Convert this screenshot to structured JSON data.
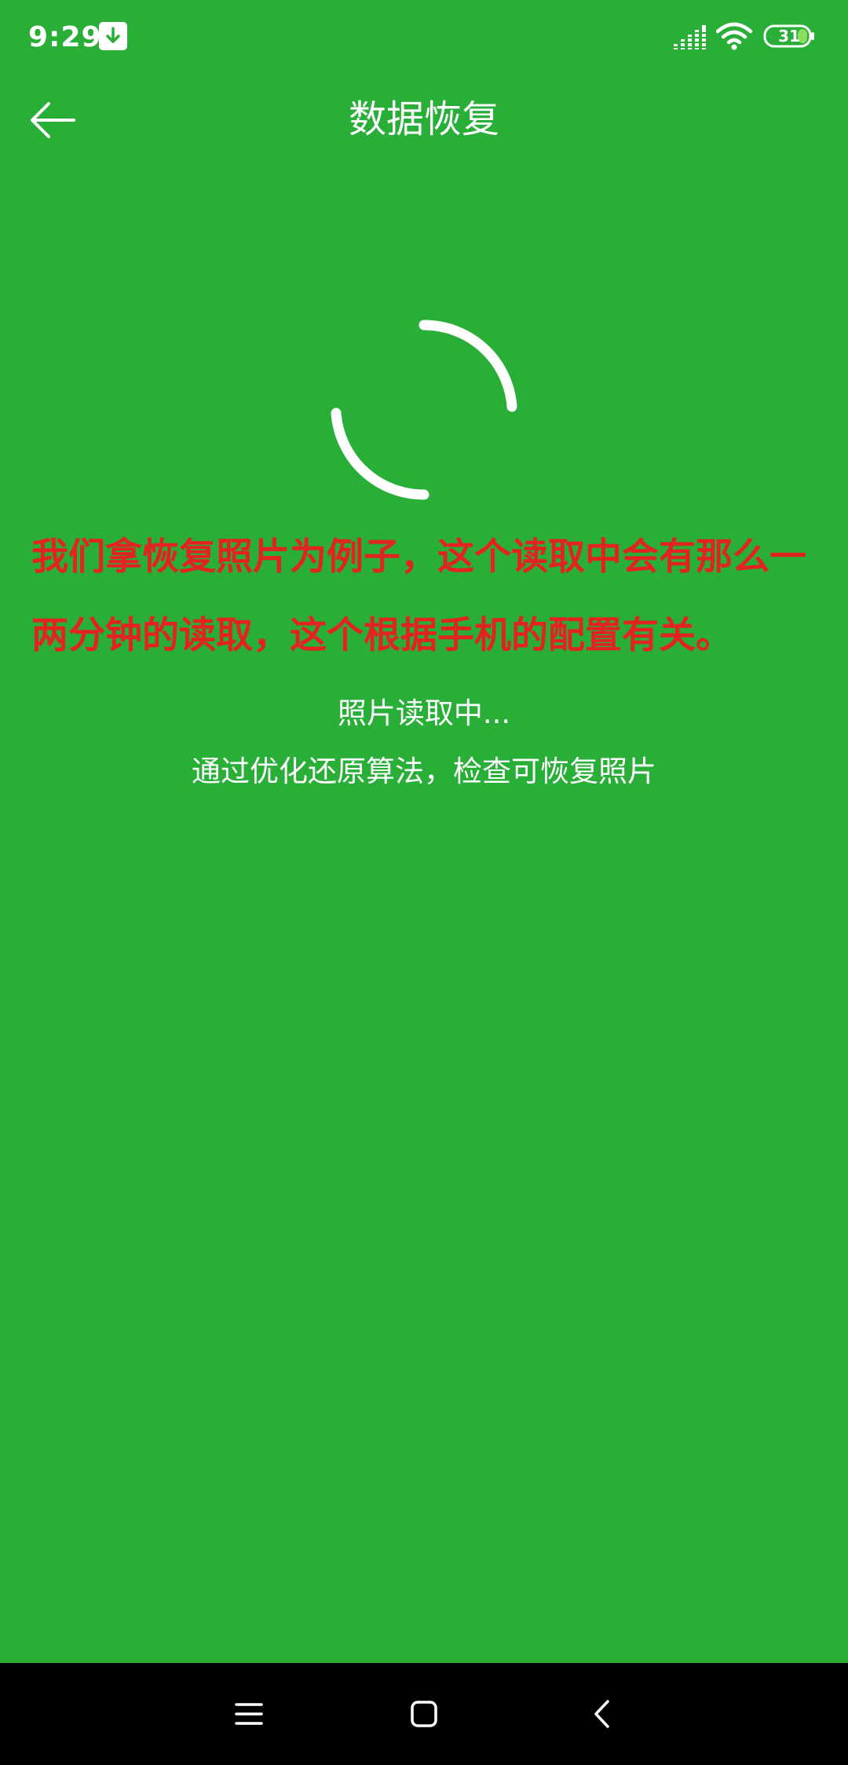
{
  "status_bar": {
    "time": "9:29",
    "battery_level": "31",
    "icons": [
      "download-notification-icon",
      "signal-icon",
      "wifi-icon",
      "battery-icon"
    ]
  },
  "toolbar": {
    "title": "数据恢复",
    "back_icon": "arrow-left-icon"
  },
  "annotation": {
    "text": "我们拿恢复照片为例子，这个读取中会有那么一两分钟的读取，这个根据手机的配置有关。",
    "color": "#e32222"
  },
  "progress": {
    "status": "照片读取中...",
    "description": "通过优化还原算法，检查可恢复照片"
  },
  "navigation": {
    "menu_icon": "menu-icon",
    "home_icon": "home-icon",
    "back_icon": "chevron-left-icon"
  },
  "colors": {
    "background": "#29ae38",
    "nav_bar": "#000000",
    "text": "#ffffff"
  }
}
